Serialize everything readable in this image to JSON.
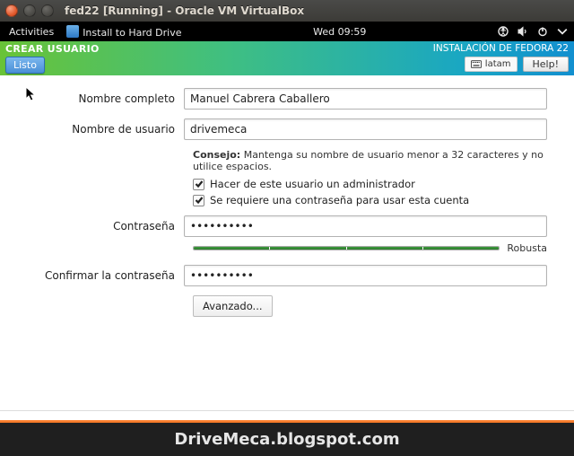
{
  "window": {
    "title": "fed22 [Running] - Oracle VM VirtualBox"
  },
  "panel": {
    "activities": "Activities",
    "install": "Install to Hard Drive",
    "clock": "Wed 09:59"
  },
  "header": {
    "title": "CREAR USUARIO",
    "done": "Listo",
    "subtitle": "INSTALACIÓN DE FEDORA 22",
    "keyboard": "latam",
    "help": "Help!"
  },
  "form": {
    "fullname_label": "Nombre completo",
    "fullname_value": "Manuel Cabrera Caballero",
    "username_label": "Nombre de usuario",
    "username_value": "drivemeca",
    "tip_prefix": "Consejo:",
    "tip_text": " Mantenga su nombre de usuario menor a 32 caracteres y no utilice espacios.",
    "admin_label": "Hacer de este usuario un administrador",
    "reqpass_label": "Se requiere una contraseña para usar esta cuenta",
    "password_label": "Contraseña",
    "password_value": "••••••••••",
    "strength_label": "Robusta",
    "confirm_label": "Confirmar la contraseña",
    "confirm_value": "••••••••••",
    "advanced": "Avanzado..."
  },
  "watermark": "DriveMeca.blogspot.com"
}
